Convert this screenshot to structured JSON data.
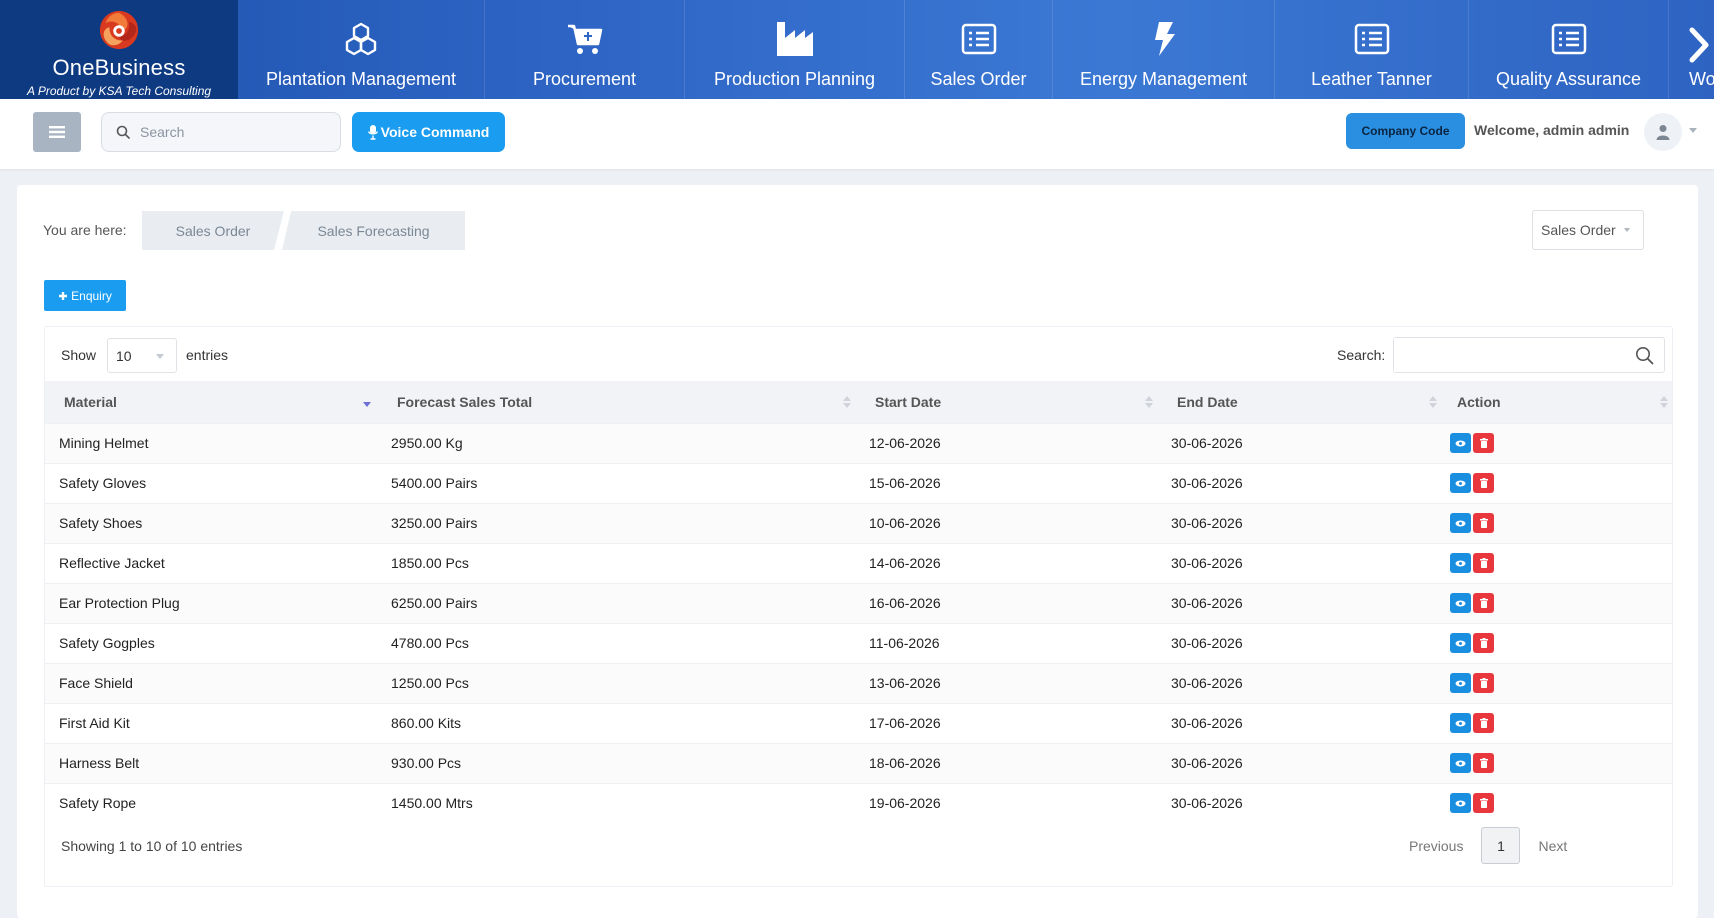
{
  "brand": {
    "name": "OneBusiness",
    "tagline": "A Product by KSA Tech Consulting"
  },
  "nav": {
    "items": [
      {
        "label": "Plantation Management",
        "icon": "cubes-icon"
      },
      {
        "label": "Procurement",
        "icon": "cart-icon"
      },
      {
        "label": "Production Planning",
        "icon": "factory-icon"
      },
      {
        "label": "Sales Order",
        "icon": "list-icon"
      },
      {
        "label": "Energy Management",
        "icon": "bolt-icon"
      },
      {
        "label": "Leather Tanner",
        "icon": "list-icon"
      },
      {
        "label": "Quality Assurance",
        "icon": "list-icon"
      },
      {
        "label": "Workload",
        "icon": "list-icon"
      }
    ]
  },
  "header": {
    "search_placeholder": "Search",
    "voice_label": "Voice Command",
    "company_code_label": "Company Code",
    "welcome": "Welcome, admin admin"
  },
  "breadcrumb": {
    "label": "You are here:",
    "items": [
      "Sales Order",
      "Sales Forecasting"
    ]
  },
  "module_select": "Sales Order",
  "enquiry_label": "Enquiry",
  "table": {
    "show_label": "Show",
    "length_value": "10",
    "entries_label": "entries",
    "search_label": "Search:",
    "columns": [
      "Material",
      "Forecast Sales Total",
      "Start Date",
      "End Date",
      "Action"
    ],
    "rows": [
      [
        "Mining Helmet",
        "2950.00 Kg",
        "12-06-2026",
        "30-06-2026"
      ],
      [
        "Safety Gloves",
        "5400.00 Pairs",
        "15-06-2026",
        "30-06-2026"
      ],
      [
        "Safety Shoes",
        "3250.00 Pairs",
        "10-06-2026",
        "30-06-2026"
      ],
      [
        "Reflective Jacket",
        "1850.00 Pcs",
        "14-06-2026",
        "30-06-2026"
      ],
      [
        "Ear Protection Plug",
        "6250.00 Pairs",
        "16-06-2026",
        "30-06-2026"
      ],
      [
        "Safety Gogples",
        "4780.00 Pcs",
        "11-06-2026",
        "30-06-2026"
      ],
      [
        "Face Shield",
        "1250.00 Pcs",
        "13-06-2026",
        "30-06-2026"
      ],
      [
        "First Aid Kit",
        "860.00 Kits",
        "17-06-2026",
        "30-06-2026"
      ],
      [
        "Harness Belt",
        "930.00 Pcs",
        "18-06-2026",
        "30-06-2026"
      ],
      [
        "Safety Rope",
        "1450.00 Mtrs",
        "19-06-2026",
        "30-06-2026"
      ]
    ],
    "info": "Showing 1 to 10 of 10 entries",
    "pagination": {
      "previous": "Previous",
      "current": "1",
      "next": "Next"
    }
  },
  "colors": {
    "nav_bg": "#2f66c6",
    "brand_bg": "#0e3a82",
    "primary": "#1a9cf0",
    "danger": "#e8383d"
  }
}
